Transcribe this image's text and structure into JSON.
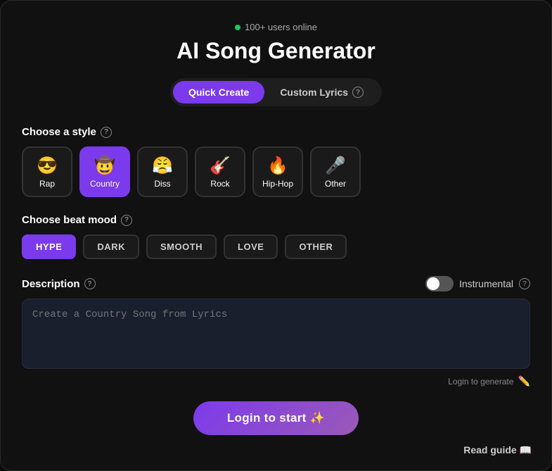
{
  "window": {
    "title": "AI Song Generator"
  },
  "online": {
    "dot_color": "#22c55e",
    "text": "100+ users online"
  },
  "tabs": {
    "quick_create": "Quick Create",
    "custom_lyrics": "Custom Lyrics"
  },
  "style_section": {
    "label": "Choose a style",
    "items": [
      {
        "id": "rap",
        "emoji": "😎",
        "label": "Rap",
        "selected": false
      },
      {
        "id": "country",
        "emoji": "🤠",
        "label": "Country",
        "selected": true
      },
      {
        "id": "diss",
        "emoji": "😤",
        "label": "Diss",
        "selected": false
      },
      {
        "id": "rock",
        "emoji": "🎸",
        "label": "Rock",
        "selected": false
      },
      {
        "id": "hiphop",
        "emoji": "🔥",
        "label": "Hip-Hop",
        "selected": false
      },
      {
        "id": "other",
        "emoji": "🎤",
        "label": "Other",
        "selected": false
      }
    ]
  },
  "mood_section": {
    "label": "Choose beat mood",
    "items": [
      {
        "id": "hype",
        "label": "HYPE",
        "active": true
      },
      {
        "id": "dark",
        "label": "DARK",
        "active": false
      },
      {
        "id": "smooth",
        "label": "SMOOTH",
        "active": false
      },
      {
        "id": "love",
        "label": "LOVE",
        "active": false
      },
      {
        "id": "other",
        "label": "OTHER",
        "active": false
      }
    ]
  },
  "description": {
    "label": "Description",
    "placeholder": "Create a Country Song from Lyrics",
    "instrumental_label": "Instrumental",
    "toggle_on": false,
    "login_to_generate": "Login to generate"
  },
  "login_btn": "Login to start ✨",
  "read_guide": "Read guide 📖"
}
